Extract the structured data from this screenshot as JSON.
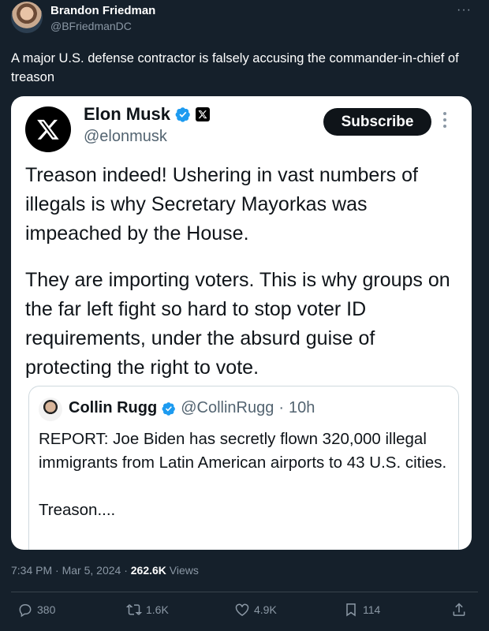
{
  "outer_tweet": {
    "author_name": "Brandon Friedman",
    "author_handle": "@BFriedmanDC",
    "more_label": "···",
    "text": "A major U.S. defense contractor is falsely accusing the commander-in-chief of treason"
  },
  "embedded_post": {
    "author_name": "Elon Musk",
    "author_handle": "@elonmusk",
    "subscribe_label": "Subscribe",
    "paragraphs": [
      "Treason indeed! Ushering in vast numbers of illegals is why Secretary Mayorkas was impeached by the House.",
      "They are importing voters. This is why groups on the far left fight so hard to stop voter ID requirements, under the absurd guise of protecting the right to vote."
    ],
    "quoted": {
      "author_name": "Collin Rugg",
      "author_handle": "@CollinRugg",
      "separator": "·",
      "time": "10h",
      "paragraphs": [
        "REPORT: Joe Biden has secretly flown 320,000 illegal immigrants from Latin American airports to 43 U.S. cities.",
        "Treason...."
      ]
    }
  },
  "meta": {
    "time": "7:34 PM",
    "sep1": " · ",
    "date": "Mar 5, 2024",
    "sep2": " · ",
    "views_count": "262.6K",
    "views_label": " Views"
  },
  "actions": {
    "replies": "380",
    "reposts": "1.6K",
    "likes": "4.9K",
    "bookmarks": "114"
  },
  "colors": {
    "background": "#15202b",
    "card": "#ffffff",
    "verified_blue": "#1d9bf0",
    "muted": "#8b98a5"
  },
  "icons": [
    "reply-icon",
    "repost-icon",
    "like-icon",
    "bookmark-icon",
    "share-icon",
    "verified-icon",
    "x-logo-icon",
    "more-icon"
  ]
}
